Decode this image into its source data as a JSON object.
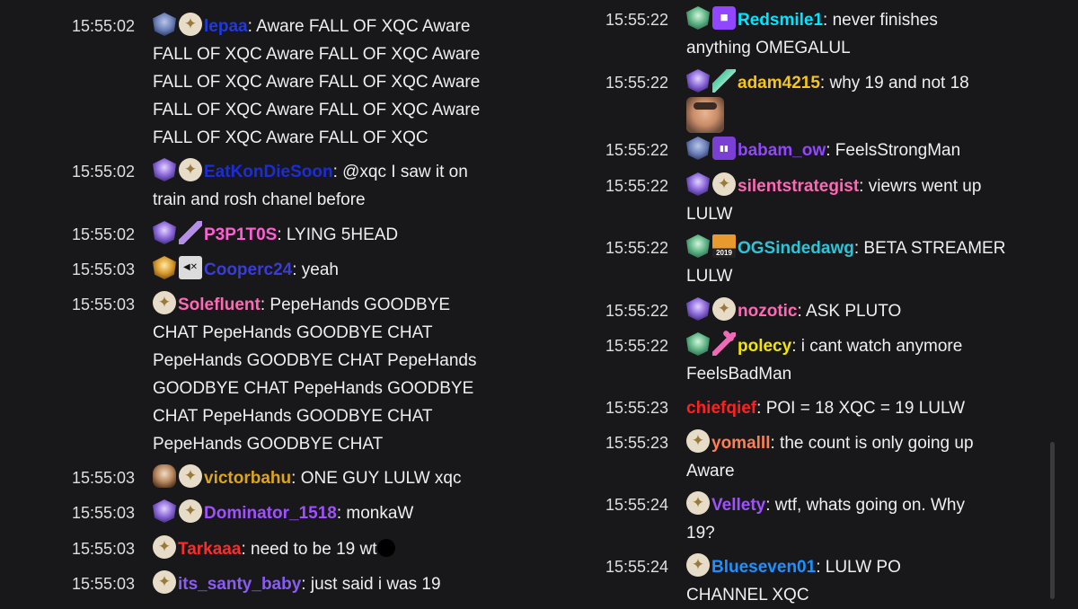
{
  "left": [
    {
      "time": "15:55:02",
      "badges": [
        "sub-blue-badge",
        "prime-badge"
      ],
      "user": "lepaa",
      "color": "#1e38e8",
      "first": "Aware FALL OF XQC Aware",
      "cont": [
        "FALL OF XQC Aware FALL OF XQC Aware",
        "FALL OF XQC Aware FALL OF XQC Aware",
        "FALL OF XQC Aware FALL OF XQC Aware",
        "FALL OF XQC Aware FALL OF XQC"
      ]
    },
    {
      "time": "15:55:02",
      "badges": [
        "sub-purple-badge",
        "prime-badge"
      ],
      "user": "EatKonDieSoon",
      "color": "#1c2dd8",
      "first": "@xqc I saw it on",
      "cont": [
        "train and rosh chanel before"
      ]
    },
    {
      "time": "15:55:02",
      "badges": [
        "sub-purple-badge",
        "sword-badge"
      ],
      "user": "P3P1T0S",
      "color": "#ff5fd2",
      "first": "LYING 5HEAD",
      "cont": []
    },
    {
      "time": "15:55:03",
      "badges": [
        "sub-gold-badge",
        "muted-badge"
      ],
      "user": "Cooperc24",
      "color": "#3b3bd6",
      "first": "yeah",
      "cont": []
    },
    {
      "time": "15:55:03",
      "badges": [
        "prime-badge"
      ],
      "user": "Solefluent",
      "color": "#ff69b4",
      "first": "PepeHands GOODBYE",
      "cont": [
        "CHAT PepeHands GOODBYE CHAT",
        "PepeHands GOODBYE CHAT PepeHands",
        "GOODBYE CHAT PepeHands GOODBYE",
        "CHAT PepeHands GOODBYE CHAT",
        "PepeHands GOODBYE CHAT"
      ]
    },
    {
      "time": "15:55:03",
      "badges": [
        "sub-skull-badge",
        "prime-badge"
      ],
      "user": "victorbahu",
      "color": "#daa520",
      "first": "ONE GUY LULW xqc",
      "cont": []
    },
    {
      "time": "15:55:03",
      "badges": [
        "sub-purple-badge",
        "prime-badge"
      ],
      "user": "Dominator_1518",
      "color": "#a050ff",
      "first": "monkaW",
      "cont": []
    },
    {
      "time": "15:55:03",
      "badges": [
        "prime-badge"
      ],
      "user": "Tarkaaa",
      "color": "#ff2b2b",
      "first": "need to be 19 wt",
      "cont": []
    },
    {
      "time": "15:55:03",
      "badges": [
        "prime-badge"
      ],
      "user": "its_santy_baby",
      "color": "#8a5cf6",
      "first": "just said i was 19",
      "cont": []
    }
  ],
  "right": [
    {
      "time": "15:55:22",
      "badges": [
        "sub-green-badge",
        "turbo-badge"
      ],
      "user": "Redsmile1",
      "color": "#00e5ff",
      "first": "never finishes",
      "cont": [
        "anything OMEGALUL"
      ]
    },
    {
      "time": "15:55:22",
      "badges": [
        "sub-purple-badge",
        "feather-badge"
      ],
      "user": "adam4215",
      "color": "#f5c518",
      "first": "why 19 and not 18",
      "cont": []
    },
    {
      "time": "15:55:22",
      "badges": [
        "sub-blue-badge",
        "twitch-badge"
      ],
      "user": "babam_ow",
      "color": "#9146ff",
      "first": "FeelsStrongMan",
      "cont": []
    },
    {
      "time": "15:55:22",
      "badges": [
        "sub-purple-badge",
        "prime-badge"
      ],
      "user": "silentstrategist",
      "color": "#ff69b4",
      "first": "viewrs went up",
      "cont": [
        "LULW"
      ]
    },
    {
      "time": "15:55:22",
      "badges": [
        "sub-green-badge",
        "2019-badge"
      ],
      "user": "OGSindedawg",
      "color": "#2ec4d6",
      "first": "BETA STREAMER",
      "cont": [
        "LULW"
      ]
    },
    {
      "time": "15:55:22",
      "badges": [
        "sub-purple-badge",
        "prime-badge"
      ],
      "user": "nozotic",
      "color": "#ff69b4",
      "first": "ASK PLUTO",
      "cont": []
    },
    {
      "time": "15:55:22",
      "badges": [
        "sub-green-badge",
        "pickaxe-badge"
      ],
      "user": "polecy",
      "color": "#f5e500",
      "first": "i cant watch anymore",
      "cont": [
        "FeelsBadMan"
      ]
    },
    {
      "time": "15:55:23",
      "badges": [],
      "user": "chiefqief",
      "color": "#ff2020",
      "first": "POI    = 18 XQC = 19 LULW",
      "cont": []
    },
    {
      "time": "15:55:23",
      "badges": [
        "prime-badge"
      ],
      "user": "yomalll",
      "color": "#ff7f50",
      "first": "the count is only going up",
      "cont": [
        "Aware"
      ]
    },
    {
      "time": "15:55:24",
      "badges": [
        "prime-badge"
      ],
      "user": "Vellety",
      "color": "#a050ff",
      "first": "wtf, whats going on. Why",
      "cont": [
        "19?"
      ]
    },
    {
      "time": "15:55:24",
      "badges": [
        "prime-badge"
      ],
      "user": "Blueseven01",
      "color": "#1e90ff",
      "first": "LULW PO",
      "cont": [
        "CHANNEL XQC"
      ]
    }
  ]
}
